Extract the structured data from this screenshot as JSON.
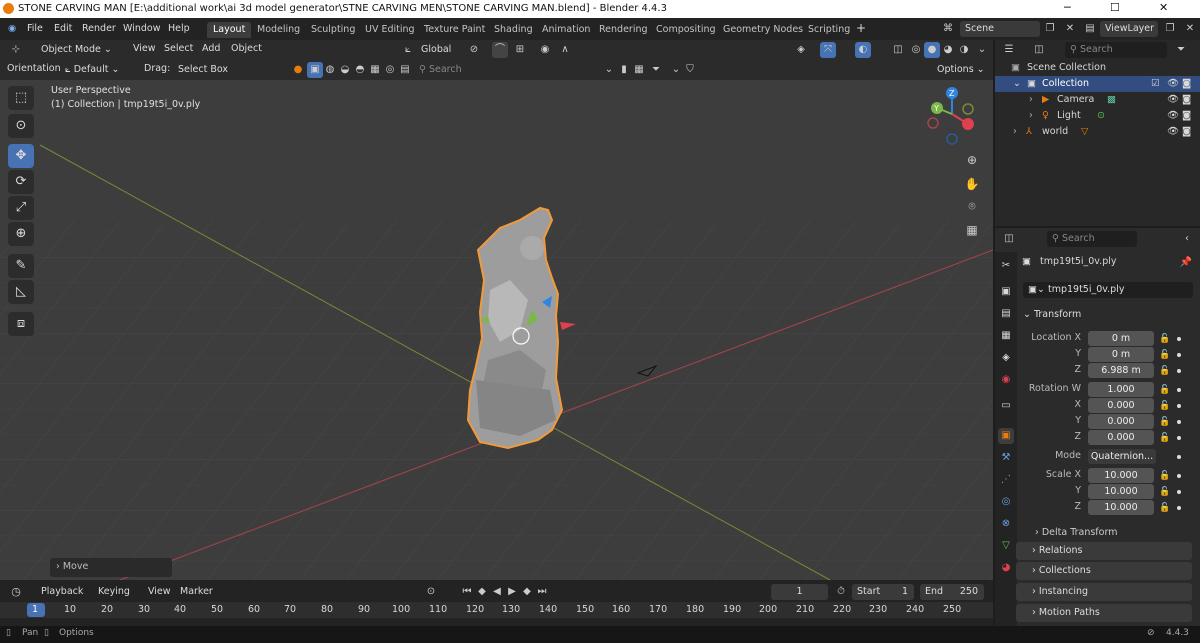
{
  "window": {
    "title": "STONE CARVING MAN [E:\\additional work\\ai 3d model generator\\STNE CARVING MEN\\STONE CARVING MAN.blend] - Blender 4.4.3"
  },
  "menu": [
    "File",
    "Edit",
    "Render",
    "Window",
    "Help"
  ],
  "workspaces": [
    "Layout",
    "Modeling",
    "Sculpting",
    "UV Editing",
    "Texture Paint",
    "Shading",
    "Animation",
    "Rendering",
    "Compositing",
    "Geometry Nodes",
    "Scripting"
  ],
  "scene": {
    "name": "Scene",
    "view_layer": "ViewLayer"
  },
  "viewport_header": {
    "mode": "Object Mode",
    "menus": [
      "View",
      "Select",
      "Add",
      "Object"
    ],
    "transform_orientation": "Global"
  },
  "tool_header": {
    "orientation_label": "Orientation:",
    "orientation_value": "Default",
    "drag_label": "Drag:",
    "drag_value": "Select Box",
    "search_placeholder": "Search",
    "options": "Options"
  },
  "viewport": {
    "perspective": "User Perspective",
    "collection_info": "(1) Collection | tmp19t5i_0v.ply",
    "last_op": "Move",
    "gizmo_axes": [
      "X",
      "Y",
      "Z"
    ]
  },
  "outliner": {
    "search_placeholder": "Search",
    "root": "Scene Collection",
    "collection": "Collection",
    "items": [
      "Camera",
      "Light",
      "world"
    ]
  },
  "properties": {
    "search_placeholder": "Search",
    "object_name": "tmp19t5i_0v.ply",
    "object_field": "tmp19t5i_0v.ply",
    "transform_header": "Transform",
    "location_label": "Location X",
    "location": [
      "0 m",
      "0 m",
      "6.988 m"
    ],
    "rotation_label": "Rotation W",
    "rotation": [
      "1.000",
      "0.000",
      "0.000",
      "0.000"
    ],
    "mode_label": "Mode",
    "mode_value": "Quaternion...",
    "scale_label": "Scale X",
    "scale": [
      "10.000",
      "10.000",
      "10.000"
    ],
    "axis_labels": [
      "X",
      "Y",
      "Z"
    ],
    "sections": [
      "Delta Transform",
      "Relations",
      "Collections",
      "Instancing",
      "Motion Paths"
    ]
  },
  "timeline": {
    "menus": [
      "Playback",
      "Keying",
      "View",
      "Marker"
    ],
    "current_frame": "1",
    "start_label": "Start",
    "start": "1",
    "end_label": "End",
    "end": "250",
    "ruler": [
      "1",
      "10",
      "20",
      "30",
      "40",
      "50",
      "60",
      "70",
      "80",
      "90",
      "100",
      "110",
      "120",
      "130",
      "140",
      "150",
      "160",
      "170",
      "180",
      "190",
      "200",
      "210",
      "220",
      "230",
      "240",
      "250"
    ]
  },
  "statusbar": {
    "pan": "Pan",
    "options": "Options",
    "version": "4.4.3"
  },
  "colors": {
    "accent": "#4772b3",
    "selection": "#e8913a",
    "x_axis": "#e0404e",
    "y_axis": "#7ab84a",
    "z_axis": "#2f84e4"
  }
}
